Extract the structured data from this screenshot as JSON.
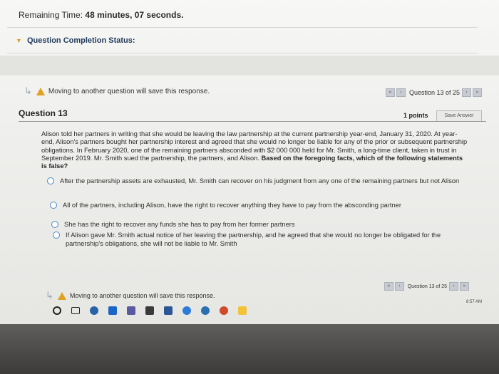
{
  "timer": {
    "label": "Remaining Time:",
    "value": "48 minutes, 07 seconds."
  },
  "status": {
    "label": "Question Completion Status:"
  },
  "warning": {
    "text": "Moving to another question will save this response."
  },
  "nav": {
    "counter": "Question 13 of 25"
  },
  "question": {
    "title": "Question 13",
    "points": "1 points",
    "save_label": "Save Answer",
    "body": "Alison told her partners in writing that she would be leaving the law partnership at the current partnership year-end, January 31, 2020. At year-end, Alison's partners bought her partnership interest and agreed that she would no longer be liable for any of the prior or subsequent partnership obligations. In February 2020, one of the remaining partners absconded with $2 000 000 held for Mr. Smith, a long-time client, taken in trust in September 2019. Mr. Smith sued the partnership, the partners, and Alison.",
    "prompt": "Based on the foregoing facts, which of the following statements is false?",
    "options": [
      "After the partnership assets are exhausted, Mr. Smith can recover on his judgment from any one of the remaining partners but not Alison",
      "All of the partners, including Alison, have the right to recover anything they have to pay from the absconding partner",
      "She has the right to recover any funds she has to pay from her former partners",
      "If Alison gave Mr. Smith actual notice of her leaving the partnership, and he agreed that she would no longer be obligated for the partnership's obligations, she will not be liable to Mr. Smith"
    ]
  },
  "footer": {
    "warning": "Moving to another question will save this response.",
    "counter": "Question 13 of 25"
  },
  "taskbar": {
    "items": [
      "cortana-circle-icon",
      "task-view-icon",
      "chrome-icon",
      "outlook-icon",
      "teams-icon",
      "store-icon",
      "word-icon",
      "edge-icon",
      "settings-icon",
      "photos-icon",
      "sticky-notes-icon"
    ],
    "colors": [
      "#222222",
      "#222222",
      "#2a62a8",
      "#1b64c8",
      "#5a5aa0",
      "#3a3a3a",
      "#2b5797",
      "#2c7bd6",
      "#2a6fb0",
      "#d04a2a",
      "#f3c33a"
    ]
  },
  "tray": {
    "time": "8:57 AM"
  }
}
